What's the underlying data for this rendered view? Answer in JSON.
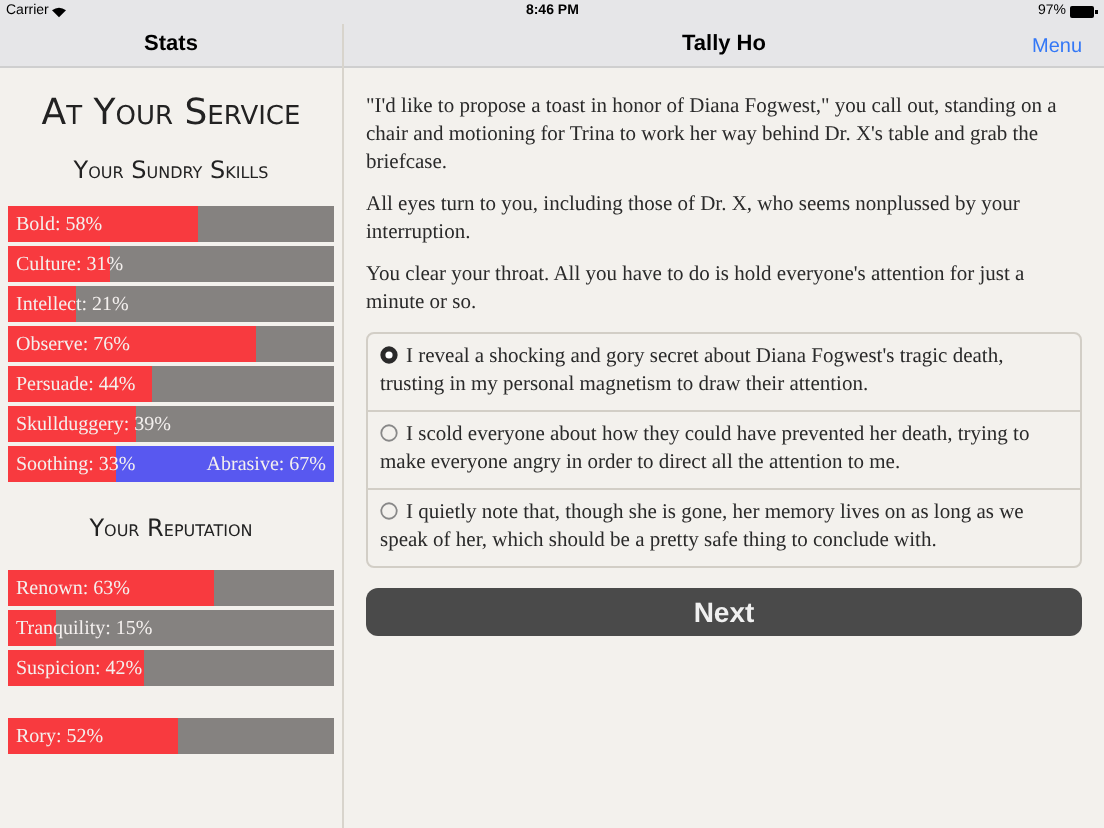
{
  "status_bar": {
    "carrier": "Carrier",
    "time": "8:46 PM",
    "battery": "97%"
  },
  "sidebar": {
    "nav_title": "Stats",
    "title": "At Your Service",
    "sections": [
      {
        "heading": "Your Sundry Skills",
        "groups": [
          [
            {
              "kind": "single",
              "label": "Bold: 58%",
              "level": 0.58
            },
            {
              "kind": "single",
              "label": "Culture: 31%",
              "level": 0.31
            },
            {
              "kind": "single",
              "label": "Intellect: 21%",
              "level": 0.21
            },
            {
              "kind": "single",
              "label": "Observe: 76%",
              "level": 0.76
            },
            {
              "kind": "single",
              "label": "Persuade: 44%",
              "level": 0.44
            },
            {
              "kind": "single",
              "label": "Skullduggery: 39%",
              "level": 0.39
            },
            {
              "kind": "opposed",
              "label": "Soothing: 33%",
              "right_label": "Abrasive: 67%",
              "level": 0.33
            }
          ]
        ]
      },
      {
        "heading": "Your Reputation",
        "groups": [
          [
            {
              "kind": "single",
              "label": "Renown: 63%",
              "level": 0.63
            },
            {
              "kind": "single",
              "label": "Tranquility: 15%",
              "level": 0.15
            },
            {
              "kind": "single",
              "label": "Suspicion: 42%",
              "level": 0.42
            }
          ],
          [
            {
              "kind": "single",
              "label": "Rory: 52%",
              "level": 0.52
            }
          ]
        ]
      }
    ]
  },
  "main": {
    "nav_title": "Tally Ho",
    "menu": "Menu",
    "paragraphs": [
      "\"I'd like to propose a toast in honor of Diana Fogwest,\" you call out, standing on a chair and motioning for Trina to work her way behind Dr. X's table and grab the briefcase.",
      "All eyes turn to you, including those of Dr. X, who seems nonplussed by your interruption.",
      "You clear your throat. All you have to do is hold everyone's attention for just a minute or so."
    ],
    "choices": [
      {
        "text": "I reveal a shocking and gory secret about Diana Fogwest's tragic death, trusting in my personal magnetism to draw their attention.",
        "selected": true
      },
      {
        "text": "I scold everyone about how they could have prevented her death, trying to make everyone angry in order to direct all the attention to me.",
        "selected": false
      },
      {
        "text": "I quietly note that, though she is gone, her memory lives on as long as we speak of her, which should be a pretty safe thing to conclude with.",
        "selected": false
      }
    ],
    "button": "Next"
  }
}
